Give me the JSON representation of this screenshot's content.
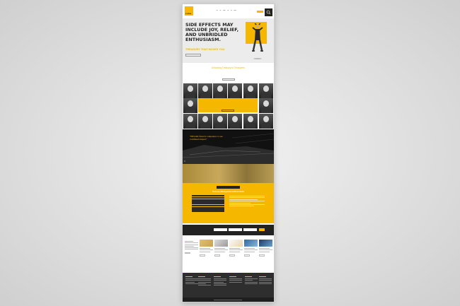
{
  "colors": {
    "accent": "#f5b700",
    "dark": "#222222",
    "hero_bg": "#ececec"
  },
  "header": {
    "logo_text": "KYRIBA",
    "nav": [
      "",
      "",
      "",
      "",
      "",
      "",
      ""
    ]
  },
  "hero": {
    "headline": "SIDE EFFECTS MAY INCLUDE JOY, RELIEF, AND UNBRIDLED ENTHUSIASM.",
    "subheadline": "TREASURY THAT MOVES YOU"
  },
  "intro": {
    "title": "Unlocking Treasury to Treasurers"
  },
  "dark_section": {
    "quote": "\"BELOR fintech companies to see combined impact\""
  },
  "yellow_section": {
    "title": "Treasury Management without limits"
  }
}
